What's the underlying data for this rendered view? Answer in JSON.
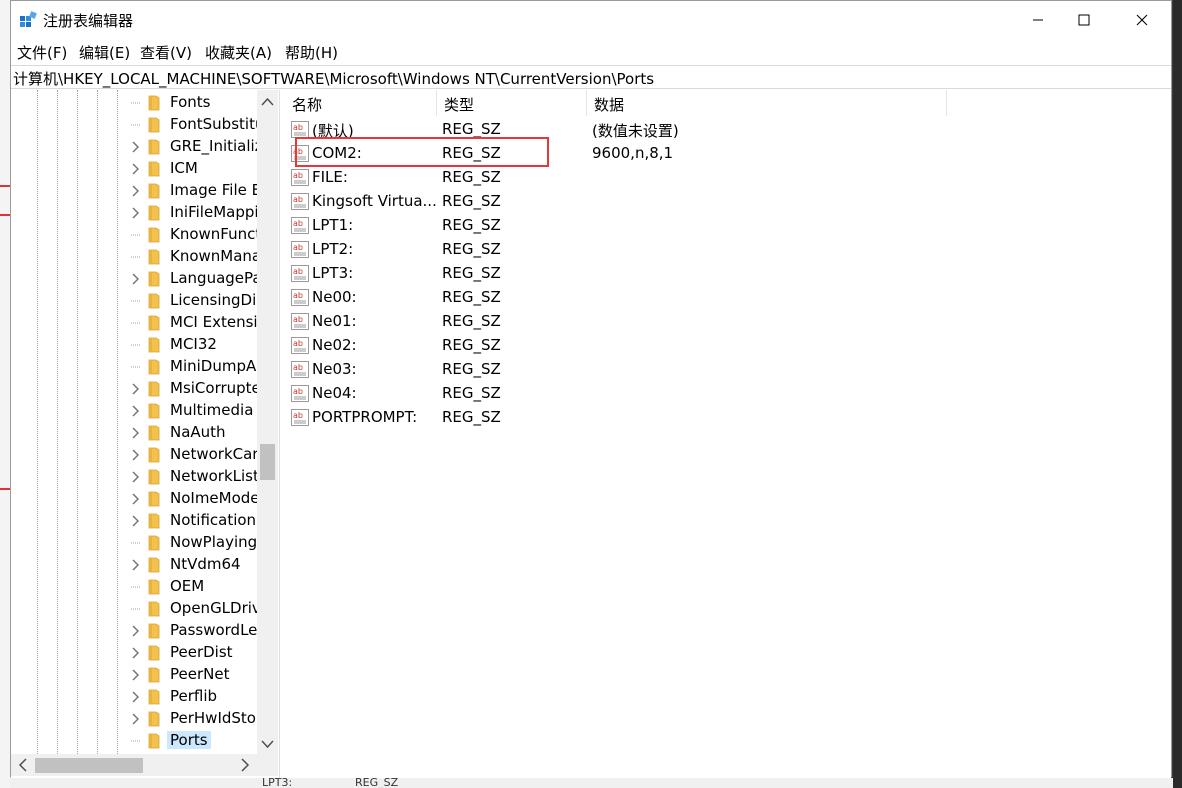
{
  "window": {
    "title": "注册表编辑器",
    "controls": [
      "minimize",
      "maximize",
      "close"
    ]
  },
  "menu": [
    "文件(F)",
    "编辑(E)",
    "查看(V)",
    "收藏夹(A)",
    "帮助(H)"
  ],
  "address": "计算机\\HKEY_LOCAL_MACHINE\\SOFTWARE\\Microsoft\\Windows NT\\CurrentVersion\\Ports",
  "tree": {
    "items": [
      {
        "label": "Fonts",
        "expandable": false
      },
      {
        "label": "FontSubstitu",
        "expandable": false
      },
      {
        "label": "GRE_Initializ",
        "expandable": true
      },
      {
        "label": "ICM",
        "expandable": true
      },
      {
        "label": "Image File E",
        "expandable": true
      },
      {
        "label": "IniFileMappi",
        "expandable": true
      },
      {
        "label": "KnownFunct",
        "expandable": false
      },
      {
        "label": "KnownMana",
        "expandable": false
      },
      {
        "label": "LanguagePa",
        "expandable": true
      },
      {
        "label": "LicensingDia",
        "expandable": false
      },
      {
        "label": "MCI Extensio",
        "expandable": false
      },
      {
        "label": "MCI32",
        "expandable": false
      },
      {
        "label": "MiniDumpA",
        "expandable": false
      },
      {
        "label": "MsiCorrupte",
        "expandable": true
      },
      {
        "label": "Multimedia",
        "expandable": true
      },
      {
        "label": "NaAuth",
        "expandable": true
      },
      {
        "label": "NetworkCar",
        "expandable": true
      },
      {
        "label": "NetworkList",
        "expandable": true
      },
      {
        "label": "NoImeMode",
        "expandable": true
      },
      {
        "label": "Notification",
        "expandable": true
      },
      {
        "label": "NowPlaying",
        "expandable": false
      },
      {
        "label": "NtVdm64",
        "expandable": true
      },
      {
        "label": "OEM",
        "expandable": false
      },
      {
        "label": "OpenGLDriv",
        "expandable": false
      },
      {
        "label": "PasswordLe",
        "expandable": true
      },
      {
        "label": "PeerDist",
        "expandable": true
      },
      {
        "label": "PeerNet",
        "expandable": true
      },
      {
        "label": "Perflib",
        "expandable": true
      },
      {
        "label": "PerHwIdSto",
        "expandable": true
      },
      {
        "label": "Ports",
        "expandable": false,
        "selected": true
      }
    ]
  },
  "values": {
    "headers": [
      "名称",
      "类型",
      "数据"
    ],
    "rows": [
      {
        "name": "(默认)",
        "type": "REG_SZ",
        "data": "(数值未设置)"
      },
      {
        "name": "COM2:",
        "type": "REG_SZ",
        "data": "9600,n,8,1",
        "highlighted": true
      },
      {
        "name": "FILE:",
        "type": "REG_SZ",
        "data": ""
      },
      {
        "name": "Kingsoft Virtua...",
        "type": "REG_SZ",
        "data": ""
      },
      {
        "name": "LPT1:",
        "type": "REG_SZ",
        "data": ""
      },
      {
        "name": "LPT2:",
        "type": "REG_SZ",
        "data": ""
      },
      {
        "name": "LPT3:",
        "type": "REG_SZ",
        "data": ""
      },
      {
        "name": "Ne00:",
        "type": "REG_SZ",
        "data": ""
      },
      {
        "name": "Ne01:",
        "type": "REG_SZ",
        "data": ""
      },
      {
        "name": "Ne02:",
        "type": "REG_SZ",
        "data": ""
      },
      {
        "name": "Ne03:",
        "type": "REG_SZ",
        "data": ""
      },
      {
        "name": "Ne04:",
        "type": "REG_SZ",
        "data": ""
      },
      {
        "name": "PORTPROMPT:",
        "type": "REG_SZ",
        "data": ""
      }
    ],
    "value_icon": "ab-string-icon"
  },
  "background": {
    "bottom_peek": [
      "LPT3:",
      "REG_SZ"
    ]
  },
  "colors": {
    "selection": "#cce8ff",
    "highlight_box": "#e53935",
    "folder": "#f2c14e"
  }
}
